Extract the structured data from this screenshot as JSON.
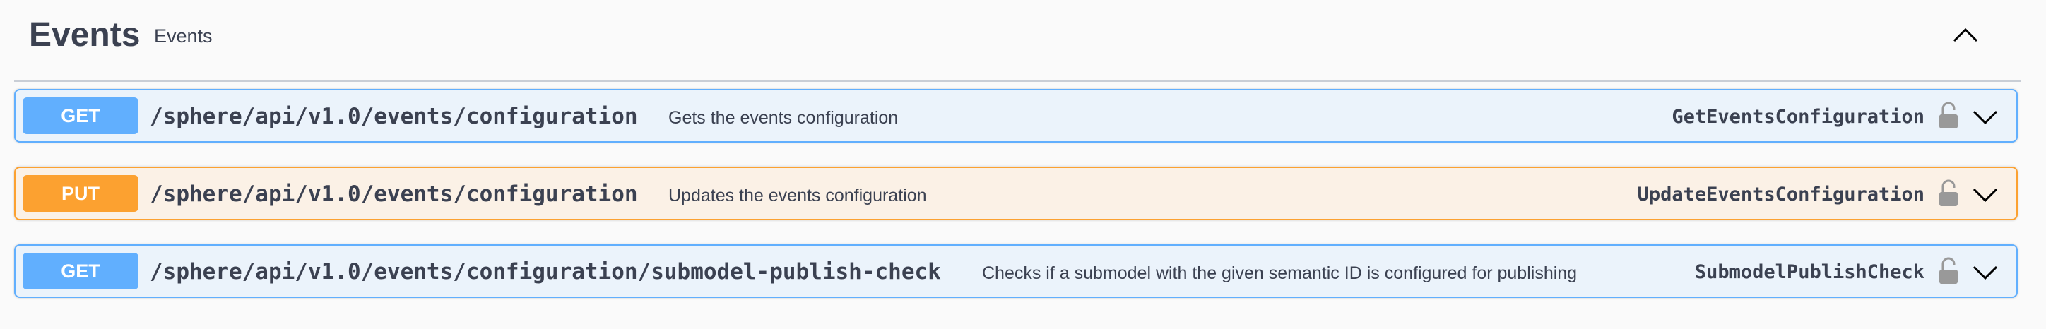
{
  "section": {
    "title": "Events",
    "description": "Events"
  },
  "operations": [
    {
      "method": "GET",
      "path": "/sphere/api/v1.0/events/configuration",
      "summary": "Gets the events configuration",
      "operation_id": "GetEventsConfiguration",
      "color": "#61affe",
      "background": "#ebf3fb"
    },
    {
      "method": "PUT",
      "path": "/sphere/api/v1.0/events/configuration",
      "summary": "Updates the events configuration",
      "operation_id": "UpdateEventsConfiguration",
      "color": "#fca130",
      "background": "#fbf1e6"
    },
    {
      "method": "GET",
      "path": "/sphere/api/v1.0/events/configuration/submodel-publish-check",
      "summary": "Checks if a submodel with the given semantic ID is configured for publishing",
      "operation_id": "SubmodelPublishCheck",
      "color": "#61affe",
      "background": "#ebf3fb"
    }
  ],
  "icons": {
    "collapse": "chevron-up-icon",
    "lock": "lock-open-icon",
    "expand": "chevron-down-icon"
  }
}
